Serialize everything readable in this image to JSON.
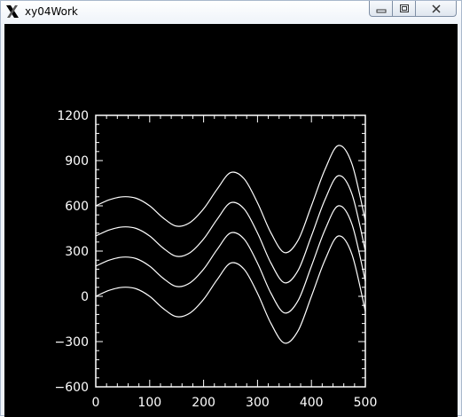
{
  "window": {
    "title": "xy04Work",
    "controls": {
      "minimize": "minimize",
      "maximize": "maximize",
      "close": "close"
    }
  },
  "chart_data": {
    "type": "line",
    "title": "",
    "xlabel": "",
    "ylabel": "",
    "xlim": [
      0,
      500
    ],
    "ylim": [
      -600,
      1200
    ],
    "x_ticks": [
      0,
      100,
      200,
      300,
      400,
      500
    ],
    "y_ticks": [
      -600,
      -300,
      0,
      300,
      600,
      900,
      1200
    ],
    "x_tick_labels": [
      "0",
      "100",
      "200",
      "300",
      "400",
      "500"
    ],
    "y_tick_labels": [
      "−600",
      "−300",
      "0",
      "300",
      "600",
      "900",
      "1200"
    ],
    "grid": false,
    "line_color": "#ffffff",
    "background": "#000000",
    "x": [
      0,
      25,
      50,
      75,
      100,
      125,
      150,
      175,
      200,
      225,
      250,
      275,
      300,
      325,
      350,
      375,
      400,
      425,
      450,
      475,
      500
    ],
    "series": [
      {
        "values": [
          0,
          40,
          60,
          50,
          0,
          -80,
          -135,
          -110,
          -20,
          110,
          220,
          180,
          20,
          -180,
          -310,
          -230,
          0,
          240,
          400,
          280,
          -100
        ]
      },
      {
        "values": [
          200,
          240,
          260,
          250,
          200,
          120,
          65,
          90,
          180,
          310,
          420,
          380,
          220,
          20,
          -110,
          -30,
          200,
          440,
          600,
          480,
          100
        ]
      },
      {
        "values": [
          400,
          440,
          460,
          450,
          400,
          320,
          265,
          290,
          380,
          510,
          620,
          580,
          420,
          220,
          90,
          170,
          400,
          640,
          800,
          680,
          300
        ]
      },
      {
        "values": [
          600,
          640,
          660,
          650,
          600,
          520,
          465,
          490,
          580,
          710,
          820,
          780,
          620,
          420,
          290,
          370,
          600,
          840,
          1000,
          880,
          500
        ]
      }
    ]
  }
}
